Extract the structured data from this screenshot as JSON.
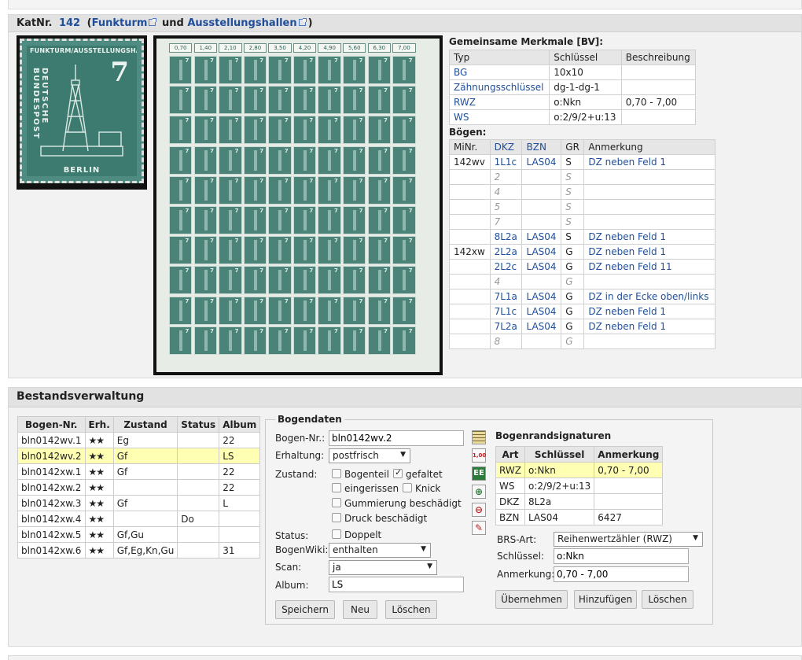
{
  "header": {
    "katnr_label": "KatNr.",
    "katnr_value": "142",
    "paren_open": "(",
    "link1": "Funkturm",
    "und": "und",
    "link2": "Ausstellungshallen",
    "paren_close": ")"
  },
  "stamp": {
    "top_text": "FUNKTURM/AUSSTELLUNGSHALLEN",
    "side_text": "DEUTSCHE BUNDESPOST",
    "value": "7",
    "bottom_text": "BERLIN"
  },
  "sheet": {
    "values": [
      "0,70",
      "1,40",
      "2,10",
      "2,80",
      "3,50",
      "4,20",
      "4,90",
      "5,60",
      "6,30",
      "7,00"
    ]
  },
  "merkmale": {
    "title": "Gemeinsame Merkmale [BV]:",
    "headers": [
      "Typ",
      "Schlüssel",
      "Beschreibung"
    ],
    "rows": [
      [
        "BG",
        "10x10",
        ""
      ],
      [
        "Zähnungsschlüssel",
        "dg-1-dg-1",
        ""
      ],
      [
        "RWZ",
        "o:Nkn",
        "0,70 - 7,00"
      ],
      [
        "WS",
        "o:2/9/2+u:13",
        ""
      ]
    ]
  },
  "boegen": {
    "title": "Bögen:",
    "headers": [
      "MiNr.",
      "DKZ",
      "BZN",
      "GR",
      "Anmerkung"
    ],
    "rows": [
      [
        "142wv",
        "1L1c",
        "LAS04",
        "S",
        "DZ neben Feld 1"
      ],
      [
        "",
        "2",
        "",
        "S",
        ""
      ],
      [
        "",
        "4",
        "",
        "S",
        ""
      ],
      [
        "",
        "5",
        "",
        "S",
        ""
      ],
      [
        "",
        "7",
        "",
        "S",
        ""
      ],
      [
        "",
        "8L2a",
        "LAS04",
        "S",
        "DZ neben Feld 1"
      ],
      [
        "142xw",
        "2L2a",
        "LAS04",
        "G",
        "DZ neben Feld 1"
      ],
      [
        "",
        "2L2c",
        "LAS04",
        "G",
        "DZ neben Feld 11"
      ],
      [
        "",
        "4",
        "",
        "G",
        ""
      ],
      [
        "",
        "7L1a",
        "LAS04",
        "G",
        "DZ in der Ecke oben/links"
      ],
      [
        "",
        "7L1c",
        "LAS04",
        "G",
        "DZ neben Feld 1"
      ],
      [
        "",
        "7L2a",
        "LAS04",
        "G",
        "DZ neben Feld 1"
      ],
      [
        "",
        "8",
        "",
        "G",
        ""
      ]
    ]
  },
  "bestand": {
    "title": "Bestandsverwaltung",
    "headers": [
      "Bogen-Nr.",
      "Erh.",
      "Zustand",
      "Status",
      "Album"
    ],
    "rows": [
      [
        "bln0142wv.1",
        "★★",
        "Eg",
        "",
        "22"
      ],
      [
        "bln0142wv.2",
        "★★",
        "Gf",
        "",
        "LS"
      ],
      [
        "bln0142xw.1",
        "★★",
        "Gf",
        "",
        "22"
      ],
      [
        "bln0142xw.2",
        "★★",
        "",
        "",
        "22"
      ],
      [
        "bln0142xw.3",
        "★★",
        "Gf",
        "",
        "L"
      ],
      [
        "bln0142xw.4",
        "★★",
        "",
        "Do",
        ""
      ],
      [
        "bln0142xw.5",
        "★★",
        "Gf,Gu",
        "",
        ""
      ],
      [
        "bln0142xw.6",
        "★★",
        "Gf,Eg,Kn,Gu",
        "",
        "31"
      ]
    ]
  },
  "bogendaten": {
    "legend": "Bogendaten",
    "bogen_nr_label": "Bogen-Nr.:",
    "bogen_nr_value": "bln0142wv.2",
    "erhaltung_label": "Erhaltung:",
    "erhaltung_value": "postfrisch",
    "zustand_label": "Zustand:",
    "cb_bogenteil": "Bogenteil",
    "cb_gefaltet": "gefaltet",
    "cb_eingerissen": "eingerissen",
    "cb_knick": "Knick",
    "cb_gummierung": "Gummierung beschädigt",
    "cb_druck": "Druck beschädigt",
    "status_label": "Status:",
    "cb_doppelt": "Doppelt",
    "bogenwiki_label": "BogenWiki:",
    "bogenwiki_value": "enthalten",
    "scan_label": "Scan:",
    "scan_value": "ja",
    "album_label": "Album:",
    "album_value": "LS",
    "btn_speichern": "Speichern",
    "btn_neu": "Neu",
    "btn_loeschen": "Löschen",
    "tool_amount": "1,00"
  },
  "brs": {
    "title": "Bogenrandsignaturen",
    "headers": [
      "Art",
      "Schlüssel",
      "Anmerkung"
    ],
    "rows": [
      [
        "RWZ",
        "o:Nkn",
        "0,70 - 7,00"
      ],
      [
        "WS",
        "o:2/9/2+u:13",
        ""
      ],
      [
        "DKZ",
        "8L2a",
        ""
      ],
      [
        "BZN",
        "LAS04",
        "6427"
      ]
    ],
    "art_label": "BRS-Art:",
    "art_value": "Reihenwertzähler (RWZ)",
    "schluessel_label": "Schlüssel:",
    "schluessel_value": "o:Nkn",
    "anmerkung_label": "Anmerkung:",
    "anmerkung_value": "0,70 - 7,00",
    "btn_uebernehmen": "Übernehmen",
    "btn_hinzufuegen": "Hinzufügen",
    "btn_loeschen": "Löschen"
  }
}
